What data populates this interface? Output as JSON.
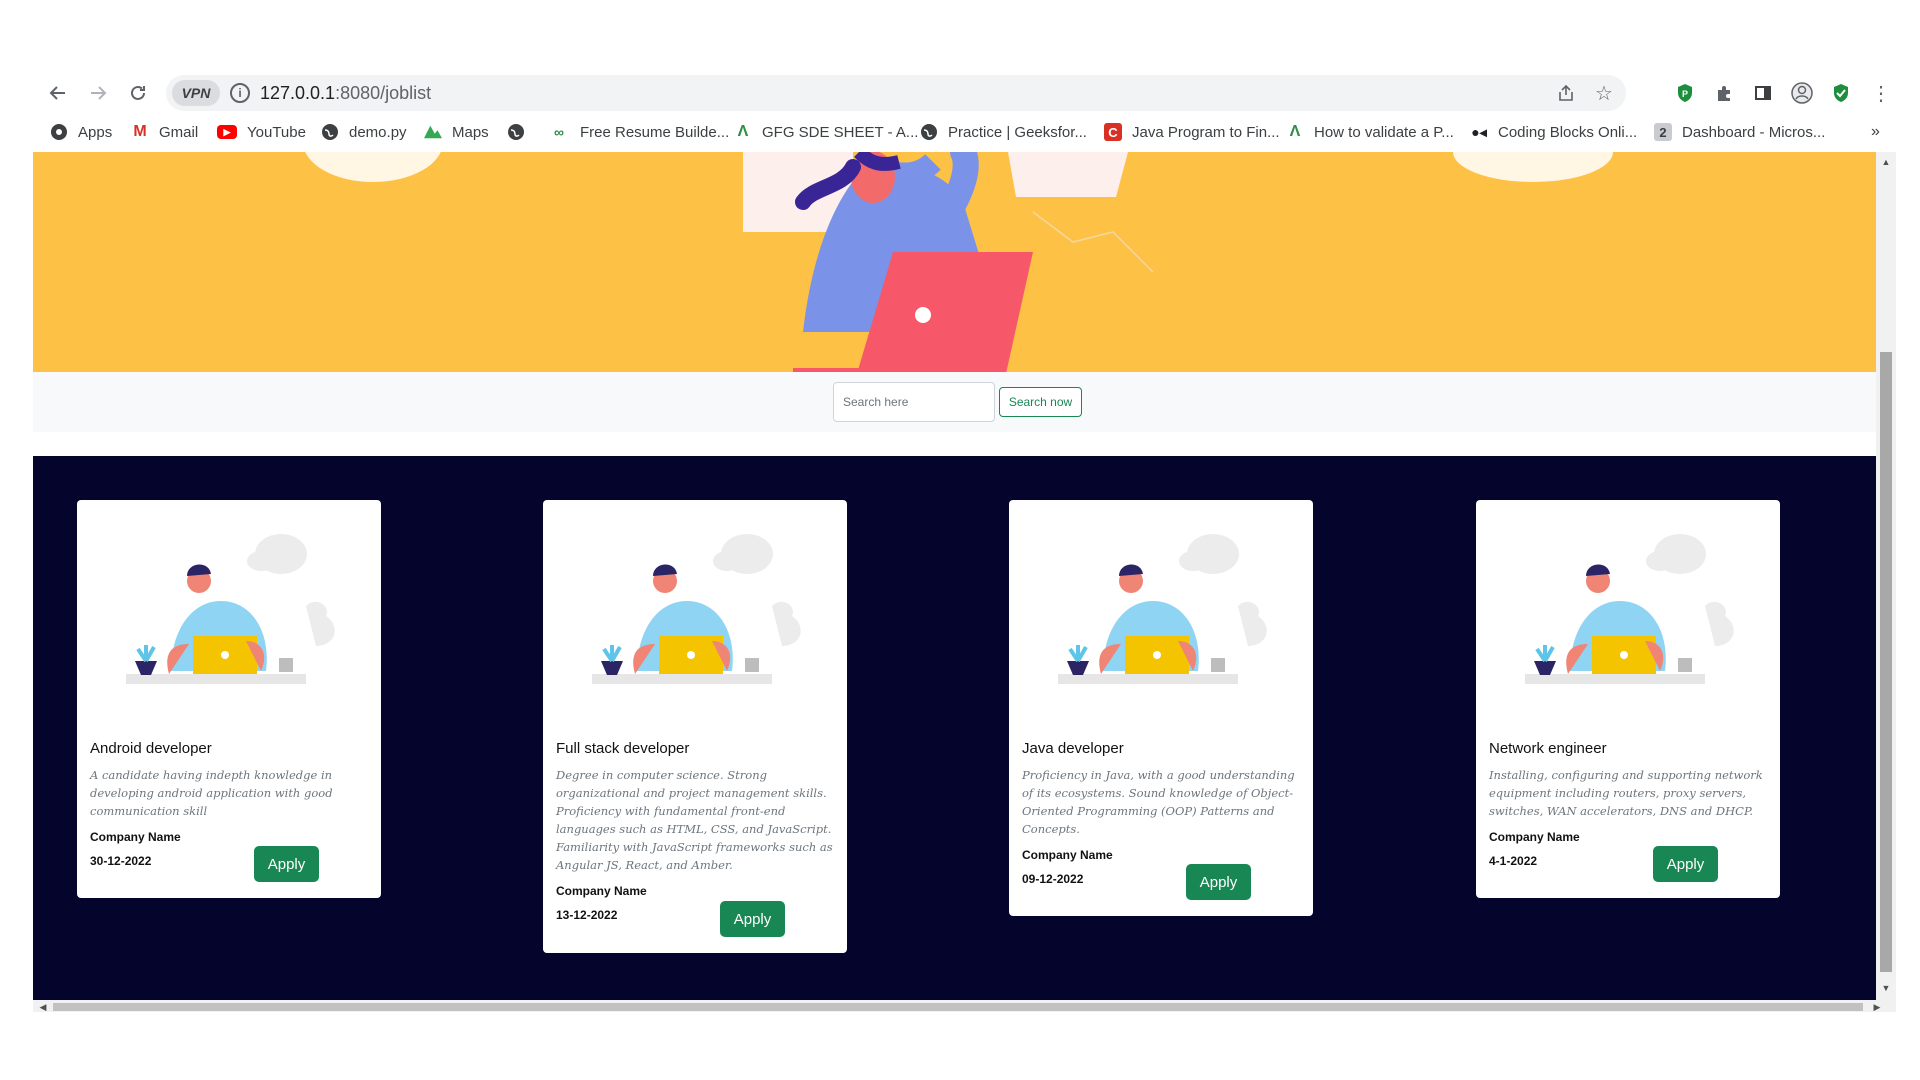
{
  "browser": {
    "vpn_label": "VPN",
    "url_host": "127.0.0.1",
    "url_path": ":8080/joblist",
    "bookmarks": [
      {
        "label": "Apps",
        "icon": "apps-icon"
      },
      {
        "label": "Gmail",
        "icon": "gmail-icon"
      },
      {
        "label": "YouTube",
        "icon": "youtube-icon"
      },
      {
        "label": "demo.py",
        "icon": "globe-icon"
      },
      {
        "label": "Maps",
        "icon": "maps-icon"
      },
      {
        "label": "",
        "icon": "globe-icon"
      },
      {
        "label": "Free Resume Builde...",
        "icon": "resume-icon"
      },
      {
        "label": "GFG SDE SHEET - A...",
        "icon": "gfg-icon"
      },
      {
        "label": "Practice | Geeksfor...",
        "icon": "globe-icon"
      },
      {
        "label": "Java Program to Fin...",
        "icon": "c-icon"
      },
      {
        "label": "How to validate a P...",
        "icon": "gfg-icon"
      },
      {
        "label": "Coding Blocks Onli...",
        "icon": "coding-blocks-icon"
      },
      {
        "label": "Dashboard - Micros...",
        "icon": "dashboard-icon"
      }
    ],
    "overflow_label": "»"
  },
  "search": {
    "placeholder": "Search here",
    "button_label": "Search now"
  },
  "colors": {
    "hero_bg": "#fdc146",
    "jobs_bg": "#04042d",
    "apply_bg": "#198754"
  },
  "jobs": [
    {
      "title": "Android developer",
      "description": "A candidate having indepth knowledge in developing android application with good communication skill",
      "company": "Company Name",
      "date": "30-12-2022",
      "apply_label": "Apply"
    },
    {
      "title": "Full stack developer",
      "description": "Degree in computer science. Strong organizational and project management skills. Proficiency with fundamental front-end languages such as HTML, CSS, and JavaScript. Familiarity with JavaScript frameworks such as Angular JS, React, and Amber.",
      "company": "Company Name",
      "date": "13-12-2022",
      "apply_label": "Apply"
    },
    {
      "title": "Java developer",
      "description": "Proficiency in Java, with a good understanding of its ecosystems. Sound knowledge of Object-Oriented Programming (OOP) Patterns and Concepts.",
      "company": "Company Name",
      "date": "09-12-2022",
      "apply_label": "Apply"
    },
    {
      "title": "Network engineer",
      "description": "Installing, configuring and supporting network equipment including routers, proxy servers, switches, WAN accelerators, DNS and DHCP.",
      "company": "Company Name",
      "date": "4-1-2022",
      "apply_label": "Apply"
    }
  ]
}
